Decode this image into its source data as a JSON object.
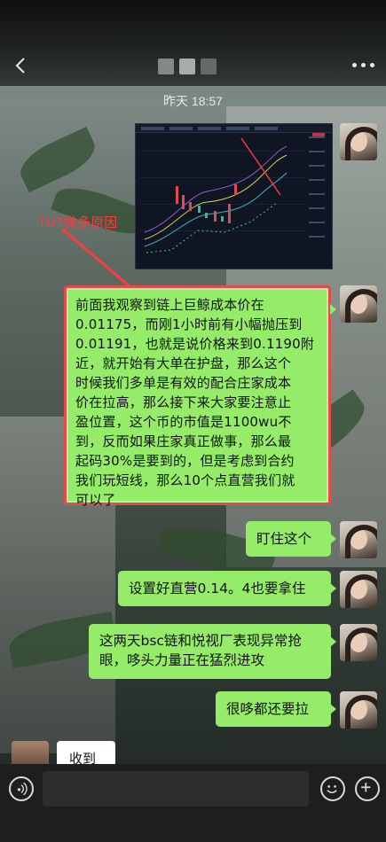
{
  "header": {
    "back_icon": "chevron-left-icon",
    "more_icon": "more-dots-icon"
  },
  "timestamp": "昨天 18:57",
  "annotation": {
    "text": "TUT做多原因",
    "color": "#ff3b3b"
  },
  "messages": [
    {
      "type": "image",
      "side": "right",
      "content": "trading-chart-screenshot"
    },
    {
      "type": "text",
      "side": "right",
      "lines": [
        "前面我观察到链上巨鲸成本价在",
        "0.01175，而刚1小时前有小幅抛压到",
        "0.01191，也就是说价格来到0.1190附",
        "近，就开始有大单在护盘，那么这个",
        "时候我们多单是有效的配合庄家成本",
        "价在拉高，那么接下来大家要注意止",
        "盈位置，这个币的市值是1100wu不",
        "到，反而如果庄家真正做事，那么最",
        "起码30%是要到的，但是考虑到合约",
        "我们玩短线，那么10个点直营我们就",
        "可以了"
      ],
      "highlight_border_color": "#e74a4a"
    },
    {
      "type": "text",
      "side": "right",
      "text": "盯住这个"
    },
    {
      "type": "text",
      "side": "right",
      "text": "设置好直营0.14。4也要拿住"
    },
    {
      "type": "text",
      "side": "right",
      "text": "这两天bsc链和悦视厂表现异常抢眼，哆头力量正在猛烈进攻"
    },
    {
      "type": "text",
      "side": "right",
      "text": "很哆都还要拉"
    },
    {
      "type": "text",
      "side": "left",
      "text": "收到"
    }
  ],
  "input_bar": {
    "voice_icon": "voice-icon",
    "emoji_icon": "emoji-icon",
    "plus_icon": "plus-icon",
    "value": ""
  },
  "colors": {
    "bubble_green": "#95ec69",
    "bubble_white": "#ffffff",
    "input_bar_bg": "#1e1e1e"
  }
}
